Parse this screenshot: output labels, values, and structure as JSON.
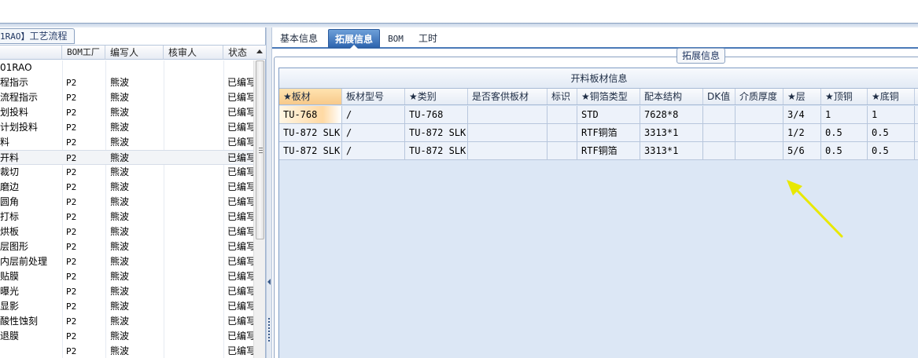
{
  "left_panel": {
    "title_code": "1RAO】",
    "title_label": "工艺流程",
    "columns": [
      "BOM工厂",
      "编写人",
      "核审人",
      "状态"
    ],
    "rows": [
      {
        "name": "01RAO",
        "bom": "",
        "writer": "",
        "checker": "",
        "status": ""
      },
      {
        "name": "程指示",
        "bom": "P2",
        "writer": "熊波",
        "checker": "",
        "status": "已编写"
      },
      {
        "name": "流程指示",
        "bom": "P2",
        "writer": "熊波",
        "checker": "",
        "status": "已编写"
      },
      {
        "name": "划投料",
        "bom": "P2",
        "writer": "熊波",
        "checker": "",
        "status": "已编写"
      },
      {
        "name": "计划投料",
        "bom": "P2",
        "writer": "熊波",
        "checker": "",
        "status": "已编写"
      },
      {
        "name": "料",
        "bom": "P2",
        "writer": "熊波",
        "checker": "",
        "status": "已编写"
      },
      {
        "name": "开料",
        "bom": "P2",
        "writer": "熊波",
        "checker": "",
        "status": "已编写"
      },
      {
        "name": "裁切",
        "bom": "P2",
        "writer": "熊波",
        "checker": "",
        "status": "已编写"
      },
      {
        "name": "磨边",
        "bom": "P2",
        "writer": "熊波",
        "checker": "",
        "status": "已编写"
      },
      {
        "name": "圆角",
        "bom": "P2",
        "writer": "熊波",
        "checker": "",
        "status": "已编写"
      },
      {
        "name": "打标",
        "bom": "P2",
        "writer": "熊波",
        "checker": "",
        "status": "已编写"
      },
      {
        "name": "烘板",
        "bom": "P2",
        "writer": "熊波",
        "checker": "",
        "status": "已编写"
      },
      {
        "name": "层图形",
        "bom": "P2",
        "writer": "熊波",
        "checker": "",
        "status": "已编写"
      },
      {
        "name": "内层前处理",
        "bom": "P2",
        "writer": "熊波",
        "checker": "",
        "status": "已编写"
      },
      {
        "name": "贴膜",
        "bom": "P2",
        "writer": "熊波",
        "checker": "",
        "status": "已编写"
      },
      {
        "name": "曝光",
        "bom": "P2",
        "writer": "熊波",
        "checker": "",
        "status": "已编写"
      },
      {
        "name": "显影",
        "bom": "P2",
        "writer": "熊波",
        "checker": "",
        "status": "已编写"
      },
      {
        "name": "酸性蚀刻",
        "bom": "P2",
        "writer": "熊波",
        "checker": "",
        "status": "已编写"
      },
      {
        "name": "退膜",
        "bom": "P2",
        "writer": "熊波",
        "checker": "",
        "status": "已编写"
      },
      {
        "name": "",
        "bom": "P2",
        "writer": "熊波",
        "checker": "",
        "status": "已编写"
      }
    ]
  },
  "tabs": [
    {
      "label": "基本信息"
    },
    {
      "label": "拓展信息"
    },
    {
      "label": "BOM"
    },
    {
      "label": "工时"
    }
  ],
  "group_title": "拓展信息",
  "grid": {
    "caption": "开料板材信息",
    "columns": [
      "★板材",
      "板材型号",
      "★类别",
      "是否客供板材",
      "标识",
      "★铜箔类型",
      "配本结构",
      "DK值",
      "介质厚度",
      "★层",
      "★顶铜",
      "★底铜"
    ],
    "rows": [
      [
        "TU-768",
        "/",
        "TU-768",
        "",
        "",
        "STD",
        "7628*8",
        "",
        "",
        "3/4",
        "1",
        "1"
      ],
      [
        "TU-872 SLK",
        "/",
        "TU-872 SLK",
        "",
        "",
        "RTF铜箔",
        "3313*1",
        "",
        "",
        "1/2",
        "0.5",
        "0.5"
      ],
      [
        "TU-872 SLK",
        "/",
        "TU-872 SLK",
        "",
        "",
        "RTF铜箔",
        "3313*1",
        "",
        "",
        "5/6",
        "0.5",
        "0.5"
      ]
    ]
  },
  "colors": {
    "accent": "#2f66b0",
    "header_highlight": "#f7c98a",
    "grid_background": "#dce7f5",
    "annotation_arrow": "#e8e800"
  }
}
